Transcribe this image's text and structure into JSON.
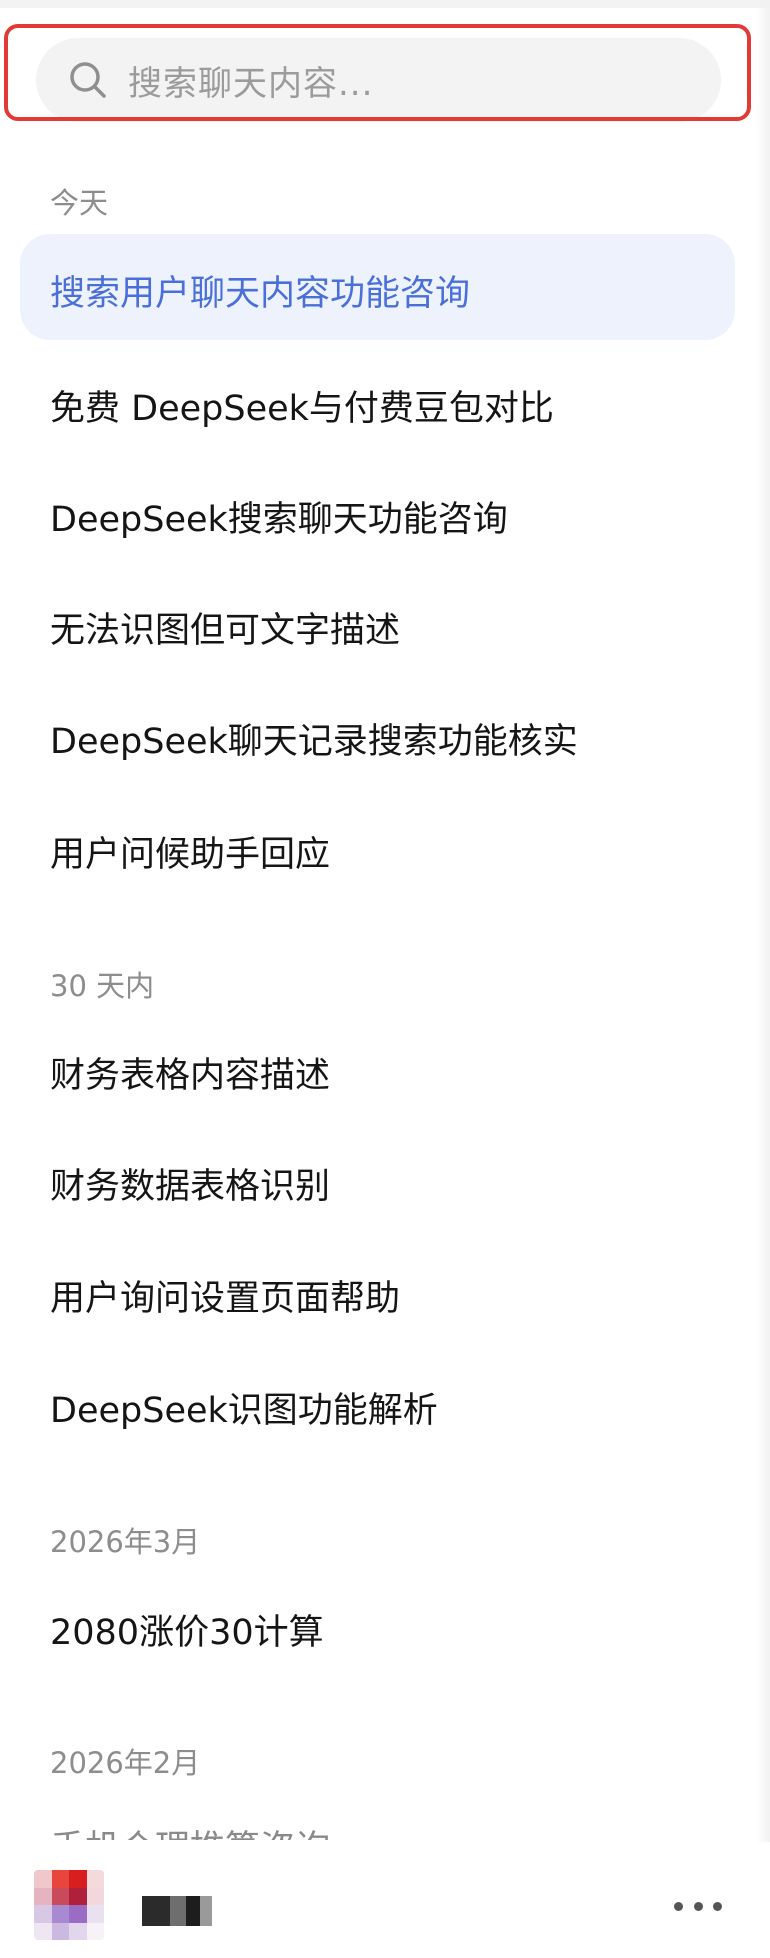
{
  "search": {
    "placeholder": "搜索聊天内容..."
  },
  "sections": [
    {
      "label": "今天",
      "items": [
        {
          "title": "搜索用户聊天内容功能咨询",
          "active": true
        },
        {
          "title": "免费 DeepSeek与付费豆包对比"
        },
        {
          "title": "DeepSeek搜索聊天功能咨询"
        },
        {
          "title": "无法识图但可文字描述"
        },
        {
          "title": "DeepSeek聊天记录搜索功能核实"
        },
        {
          "title": "用户问候助手回应"
        }
      ]
    },
    {
      "label": "30 天内",
      "items": [
        {
          "title": "财务表格内容描述"
        },
        {
          "title": "财务数据表格识别"
        },
        {
          "title": "用户询问设置页面帮助"
        },
        {
          "title": "DeepSeek识图功能解析"
        }
      ]
    },
    {
      "label": "2026年3月",
      "items": [
        {
          "title": "2080涨价30计算"
        }
      ]
    },
    {
      "label": "2026年2月",
      "items": [
        {
          "title": "手机合理推算咨询"
        }
      ]
    }
  ],
  "icons": {
    "search": "search-icon",
    "more": "more-icon"
  },
  "colors": {
    "highlight_border": "#e23a36",
    "active_text": "#4a6fd9",
    "active_bg": "#eef2fd"
  }
}
